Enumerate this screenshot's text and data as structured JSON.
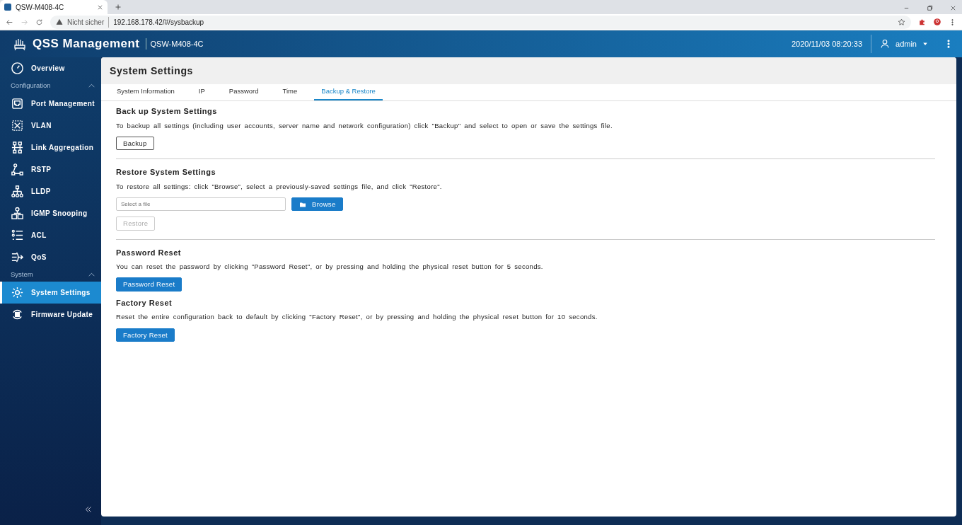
{
  "browser": {
    "tab_title": "QSW-M408-4C",
    "security": "Nicht sicher",
    "url": "192.168.178.42/#/sysbackup"
  },
  "header": {
    "app_title": "QSS Management",
    "device": "QSW-M408-4C",
    "datetime": "2020/11/03 08:20:33",
    "user": "admin"
  },
  "sidebar": {
    "entries": [
      {
        "kind": "item",
        "label": "Overview",
        "selected": false
      },
      {
        "kind": "section",
        "label": "Configuration",
        "expanded": true
      },
      {
        "kind": "item",
        "label": "Port Management",
        "selected": false
      },
      {
        "kind": "item",
        "label": "VLAN",
        "selected": false
      },
      {
        "kind": "item",
        "label": "Link Aggregation",
        "selected": false
      },
      {
        "kind": "item",
        "label": "RSTP",
        "selected": false
      },
      {
        "kind": "item",
        "label": "LLDP",
        "selected": false
      },
      {
        "kind": "item",
        "label": "IGMP Snooping",
        "selected": false
      },
      {
        "kind": "item",
        "label": "ACL",
        "selected": false
      },
      {
        "kind": "item",
        "label": "QoS",
        "selected": false
      },
      {
        "kind": "section",
        "label": "System",
        "expanded": true
      },
      {
        "kind": "item",
        "label": "System Settings",
        "selected": true
      },
      {
        "kind": "item",
        "label": "Firmware Update",
        "selected": false
      }
    ]
  },
  "page": {
    "title": "System Settings",
    "tabs": [
      {
        "label": "System Information",
        "selected": false
      },
      {
        "label": "IP",
        "selected": false
      },
      {
        "label": "Password",
        "selected": false
      },
      {
        "label": "Time",
        "selected": false
      },
      {
        "label": "Backup & Restore",
        "selected": true
      }
    ],
    "sections": [
      {
        "title": "Back up System Settings",
        "text": "To backup all settings (including user accounts, server name and network configuration) click \"Backup\" and select to open or save the settings file.",
        "controls": [
          {
            "kind": "outline",
            "label": "Backup",
            "disabled": false
          }
        ]
      },
      {
        "kind": "divider"
      },
      {
        "title": "Restore System Settings",
        "text": "To restore all settings: click \"Browse\", select a previously-saved settings file, and click \"Restore\".",
        "controls": [
          {
            "kind": "file",
            "placeholder": "Select a file",
            "button": "Browse"
          },
          {
            "kind": "outline",
            "label": "Restore",
            "disabled": true
          }
        ]
      },
      {
        "kind": "divider"
      },
      {
        "title": "Password Reset",
        "text": "You can reset the password by clicking \"Password Reset\", or by pressing and holding the physical reset button for 5 seconds.",
        "controls": [
          {
            "kind": "primary",
            "label": "Password Reset",
            "disabled": false
          }
        ]
      },
      {
        "title": "Factory Reset",
        "text": "Reset the entire configuration back to default by clicking \"Factory Reset\", or by pressing and holding the physical reset button for 10 seconds.",
        "controls": [
          {
            "kind": "primary",
            "label": "Factory Reset",
            "disabled": false
          }
        ]
      }
    ]
  }
}
